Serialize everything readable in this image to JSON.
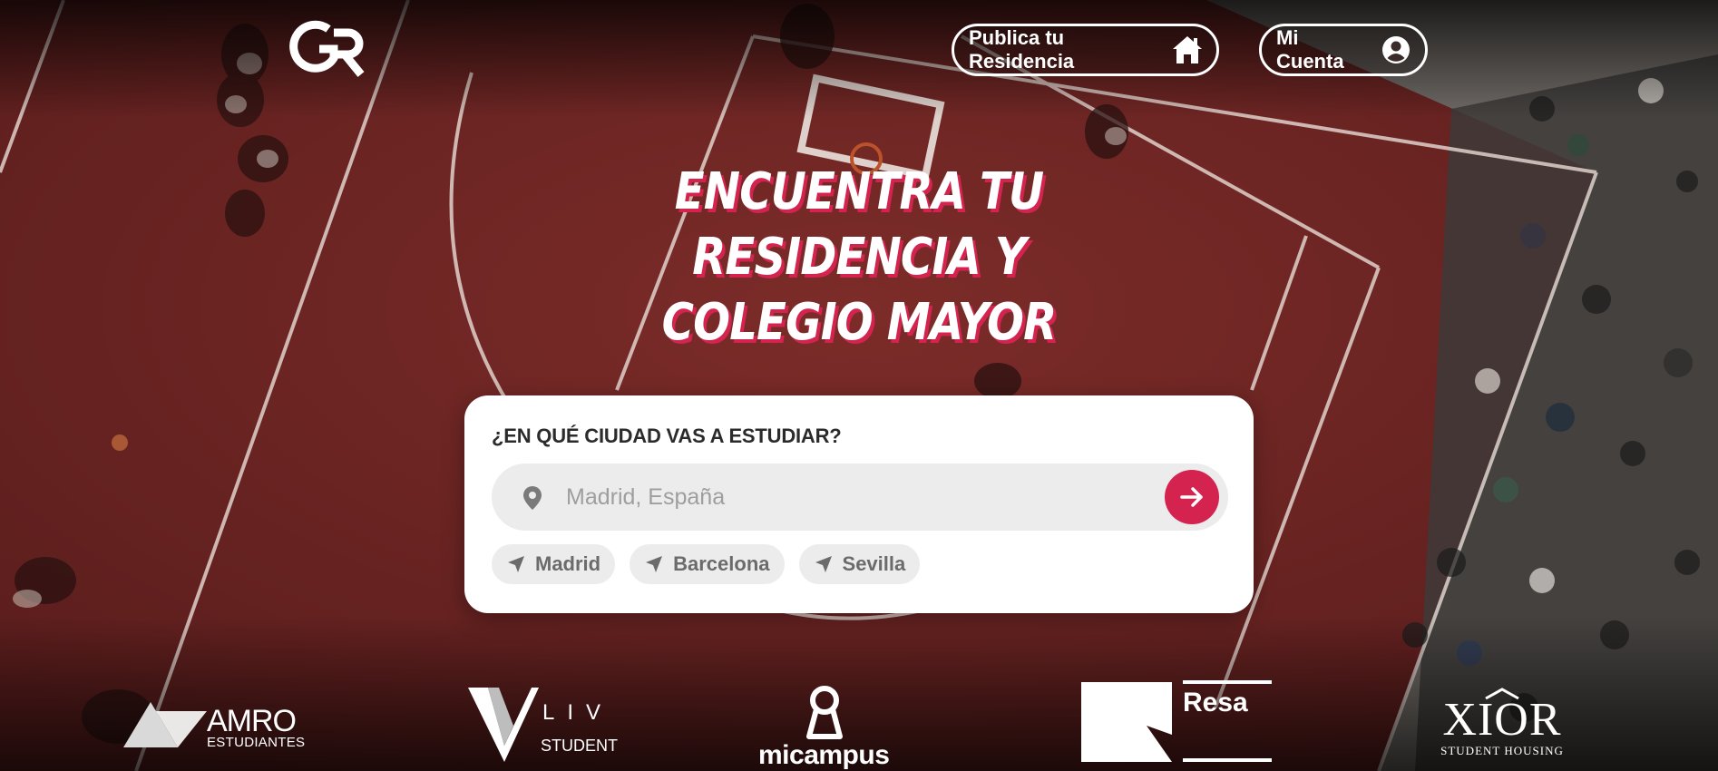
{
  "header": {
    "logo_text": "GR",
    "publish_button_label": "Publica tu Residencia",
    "account_button_label": "Mi Cuenta"
  },
  "hero": {
    "title_line1": "ENCUENTRA TU",
    "title_line2": "RESIDENCIA Y",
    "title_line3": "COLEGIO MAYOR"
  },
  "search": {
    "question": "¿EN QUÉ CIUDAD VAS A ESTUDIAR?",
    "placeholder": "Madrid, España",
    "value": "",
    "chips": [
      {
        "label": "Madrid",
        "icon": "navigation-arrow-icon"
      },
      {
        "label": "Barcelona",
        "icon": "navigation-arrow-icon"
      },
      {
        "label": "Sevilla",
        "icon": "navigation-arrow-icon"
      }
    ]
  },
  "partners": {
    "amro": {
      "name": "AMRO",
      "sub": "ESTUDIANTES"
    },
    "liv": {
      "name": "LIV",
      "sub": "STUDENT"
    },
    "micampus": {
      "name": "micampus"
    },
    "resa": {
      "name": "Resa"
    },
    "xior": {
      "name": "XIOR",
      "sub": "STUDENT HOUSING"
    }
  },
  "colors": {
    "accent": "#d4234f",
    "court": "#7a2a27",
    "card_bg": "#ffffff",
    "input_bg": "#ececec"
  }
}
